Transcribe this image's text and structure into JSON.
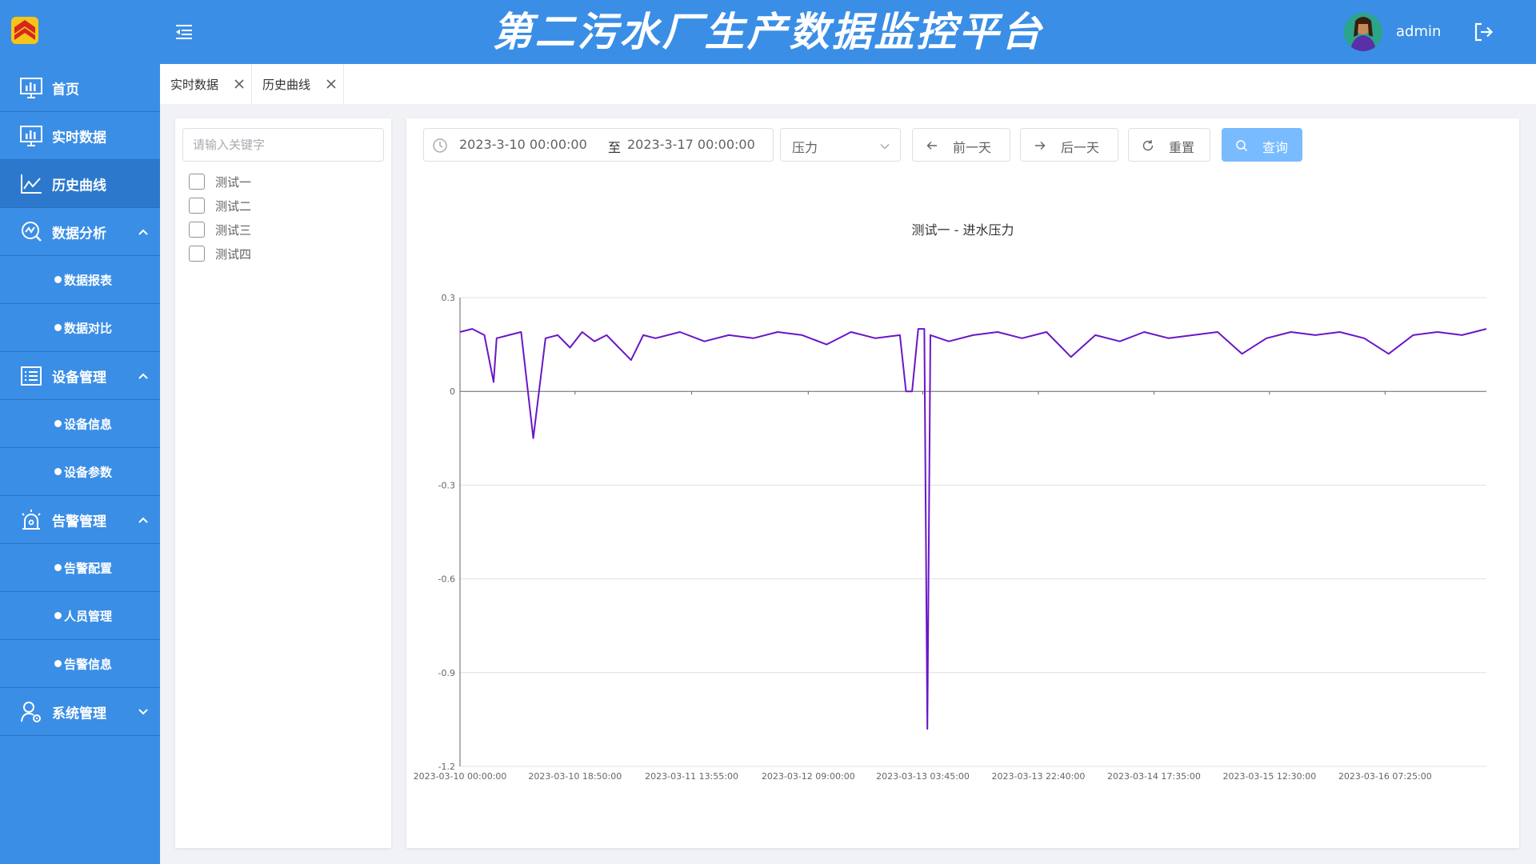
{
  "header": {
    "title": "第二污水厂生产数据监控平台",
    "username": "admin",
    "brand_color": "#3a8ee6"
  },
  "sidebar": {
    "items": [
      {
        "label": "首页",
        "icon": "dashboard-icon"
      },
      {
        "label": "实时数据",
        "icon": "bar-chart-icon"
      },
      {
        "label": "历史曲线",
        "icon": "line-chart-icon",
        "active": true
      },
      {
        "label": "数据分析",
        "icon": "analysis-icon",
        "expanded": true
      },
      {
        "label": "数据报表"
      },
      {
        "label": "数据对比"
      },
      {
        "label": "设备管理",
        "icon": "list-icon",
        "expanded": true
      },
      {
        "label": "设备信息"
      },
      {
        "label": "设备参数"
      },
      {
        "label": "告警管理",
        "icon": "alarm-icon",
        "expanded": true
      },
      {
        "label": "告警配置"
      },
      {
        "label": "人员管理"
      },
      {
        "label": "告警信息"
      },
      {
        "label": "系统管理",
        "icon": "user-settings-icon",
        "expanded": false
      }
    ]
  },
  "tabs": [
    {
      "label": "实时数据"
    },
    {
      "label": "历史曲线"
    }
  ],
  "filter": {
    "search_placeholder": "请输入关键字",
    "options": [
      "测试一",
      "测试二",
      "测试三",
      "测试四"
    ]
  },
  "toolbar": {
    "start_date": "2023-3-10  00:00:00",
    "separator": "至",
    "end_date": "2023-3-17  00:00:00",
    "metric": "压力",
    "prev_label": "前一天",
    "next_label": "后一天",
    "reset_label": "重置",
    "query_label": "查询"
  },
  "chart_data": {
    "type": "line",
    "title": "测试一 - 进水压力",
    "ylim": [
      -1.2,
      0.3
    ],
    "yticks": [
      "0.3",
      "0",
      "-0.3",
      "-0.6",
      "-0.9",
      "-1.2"
    ],
    "ytick_values": [
      0.3,
      0,
      -0.3,
      -0.6,
      -0.9,
      -1.2
    ],
    "xticks": [
      "2023-03-10 00:00:00",
      "2023-03-10 18:50:00",
      "2023-03-11 13:55:00",
      "2023-03-12 09:00:00",
      "2023-03-13 03:45:00",
      "2023-03-13 22:40:00",
      "2023-03-14 17:35:00",
      "2023-03-15 12:30:00",
      "2023-03-16 07:25:00"
    ],
    "grid": true,
    "line_color": "#6a16c8",
    "series": [
      {
        "x": [
          "2023-03-10 00:00",
          "2023-03-10 02:00",
          "2023-03-10 04:00",
          "2023-03-10 05:30",
          "2023-03-10 06:00",
          "2023-03-10 08:00",
          "2023-03-10 10:00",
          "2023-03-10 12:00",
          "2023-03-10 14:00",
          "2023-03-10 16:00",
          "2023-03-10 18:00",
          "2023-03-10 20:00",
          "2023-03-10 22:00",
          "2023-03-11 00:00",
          "2023-03-11 04:00",
          "2023-03-11 06:00",
          "2023-03-11 08:00",
          "2023-03-11 12:00",
          "2023-03-11 16:00",
          "2023-03-11 20:00",
          "2023-03-12 00:00",
          "2023-03-12 04:00",
          "2023-03-12 08:00",
          "2023-03-12 12:00",
          "2023-03-12 16:00",
          "2023-03-12 20:00",
          "2023-03-13 00:00",
          "2023-03-13 01:00",
          "2023-03-13 02:00",
          "2023-03-13 03:00",
          "2023-03-13 04:00",
          "2023-03-13 04:30",
          "2023-03-13 05:00",
          "2023-03-13 08:00",
          "2023-03-13 12:00",
          "2023-03-13 16:00",
          "2023-03-13 20:00",
          "2023-03-14 00:00",
          "2023-03-14 04:00",
          "2023-03-14 08:00",
          "2023-03-14 12:00",
          "2023-03-14 16:00",
          "2023-03-14 20:00",
          "2023-03-15 00:00",
          "2023-03-15 04:00",
          "2023-03-15 08:00",
          "2023-03-15 12:00",
          "2023-03-15 16:00",
          "2023-03-15 20:00",
          "2023-03-16 00:00",
          "2023-03-16 04:00",
          "2023-03-16 08:00",
          "2023-03-16 12:00",
          "2023-03-16 16:00",
          "2023-03-16 20:00",
          "2023-03-17 00:00"
        ],
        "values": [
          0.19,
          0.2,
          0.18,
          0.03,
          0.17,
          0.18,
          0.19,
          -0.15,
          0.17,
          0.18,
          0.14,
          0.19,
          0.16,
          0.18,
          0.1,
          0.18,
          0.17,
          0.19,
          0.16,
          0.18,
          0.17,
          0.19,
          0.18,
          0.15,
          0.19,
          0.17,
          0.18,
          0.0,
          0.0,
          0.2,
          0.2,
          -1.08,
          0.18,
          0.16,
          0.18,
          0.19,
          0.17,
          0.19,
          0.11,
          0.18,
          0.16,
          0.19,
          0.17,
          0.18,
          0.19,
          0.12,
          0.17,
          0.19,
          0.18,
          0.19,
          0.17,
          0.12,
          0.18,
          0.19,
          0.18,
          0.2
        ]
      }
    ]
  }
}
